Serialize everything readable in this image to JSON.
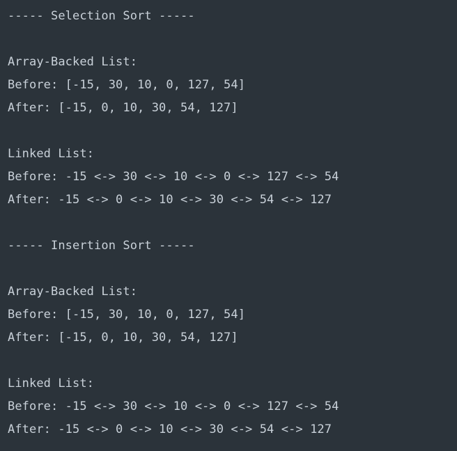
{
  "console": {
    "lines": [
      "----- Selection Sort -----",
      "",
      "Array-Backed List:",
      "Before: [-15, 30, 10, 0, 127, 54]",
      "After: [-15, 0, 10, 30, 54, 127]",
      "",
      "Linked List:",
      "Before: -15 <-> 30 <-> 10 <-> 0 <-> 127 <-> 54",
      "After: -15 <-> 0 <-> 10 <-> 30 <-> 54 <-> 127",
      "",
      "----- Insertion Sort -----",
      "",
      "Array-Backed List:",
      "Before: [-15, 30, 10, 0, 127, 54]",
      "After: [-15, 0, 10, 30, 54, 127]",
      "",
      "Linked List:",
      "Before: -15 <-> 30 <-> 10 <-> 0 <-> 127 <-> 54",
      "After: -15 <-> 0 <-> 10 <-> 30 <-> 54 <-> 127"
    ]
  }
}
